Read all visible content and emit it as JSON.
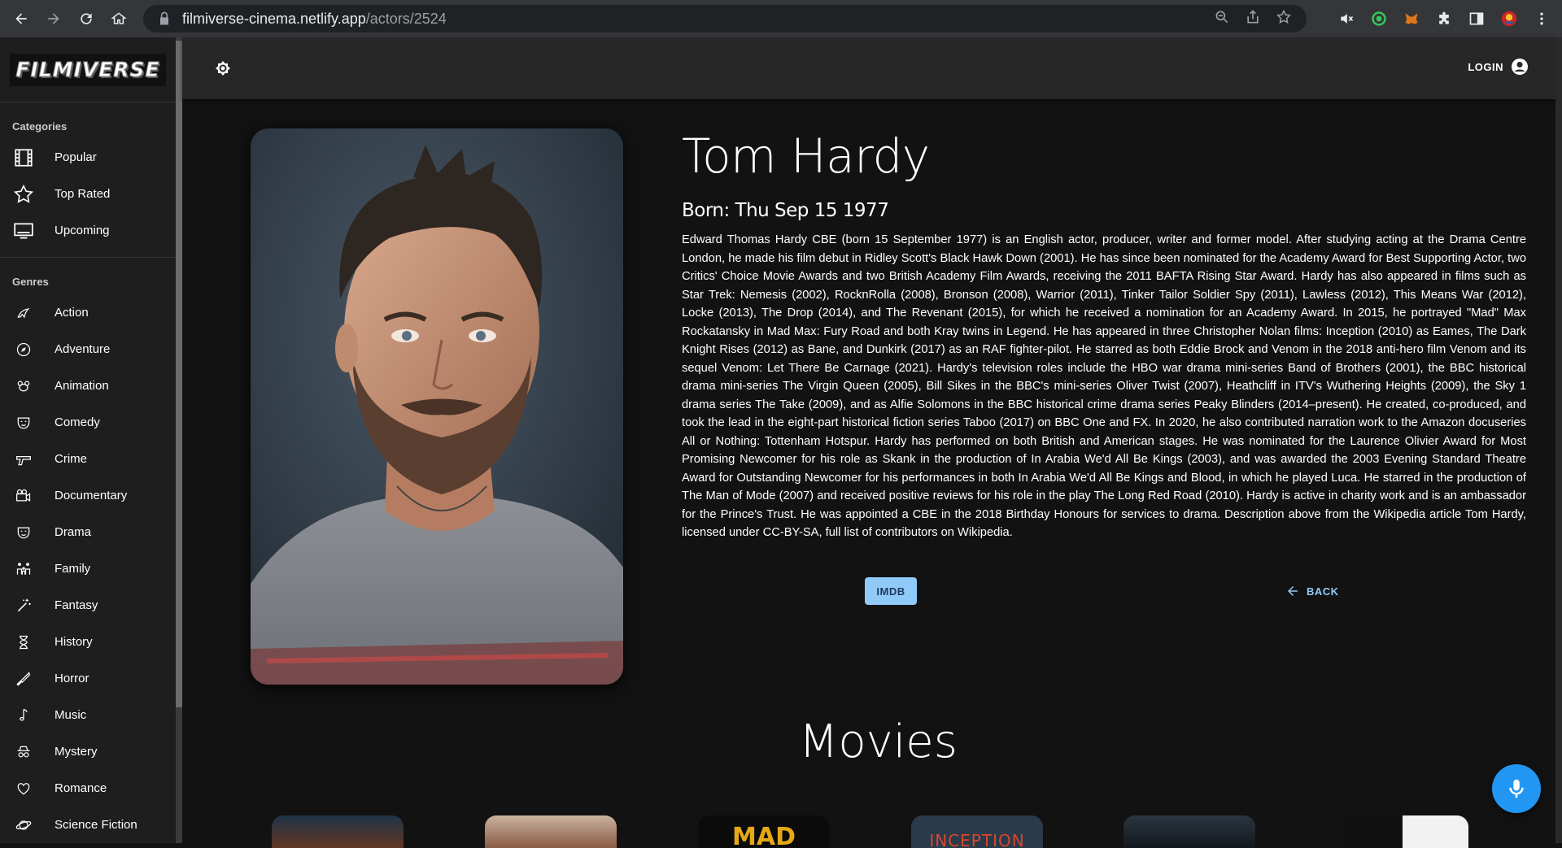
{
  "browser": {
    "url_host": "filmiverse-cinema.netlify.app",
    "url_path": "/actors/2524"
  },
  "sidebar": {
    "logo_text": "FILMIVERSE",
    "categories_title": "Categories",
    "categories": [
      {
        "label": "Popular",
        "icon": "film-icon"
      },
      {
        "label": "Top Rated",
        "icon": "star-icon"
      },
      {
        "label": "Upcoming",
        "icon": "tv-icon"
      }
    ],
    "genres_title": "Genres",
    "genres": [
      {
        "label": "Action",
        "icon": "action-icon"
      },
      {
        "label": "Adventure",
        "icon": "compass-icon"
      },
      {
        "label": "Animation",
        "icon": "animation-icon"
      },
      {
        "label": "Comedy",
        "icon": "mask-icon"
      },
      {
        "label": "Crime",
        "icon": "gun-icon"
      },
      {
        "label": "Documentary",
        "icon": "camera-icon"
      },
      {
        "label": "Drama",
        "icon": "mask-icon"
      },
      {
        "label": "Family",
        "icon": "family-icon"
      },
      {
        "label": "Fantasy",
        "icon": "wand-icon"
      },
      {
        "label": "History",
        "icon": "hourglass-icon"
      },
      {
        "label": "Horror",
        "icon": "knife-icon"
      },
      {
        "label": "Music",
        "icon": "music-note-icon"
      },
      {
        "label": "Mystery",
        "icon": "spy-icon"
      },
      {
        "label": "Romance",
        "icon": "heart-icon"
      },
      {
        "label": "Science Fiction",
        "icon": "planet-icon"
      }
    ]
  },
  "topbar": {
    "login_label": "LOGIN"
  },
  "actor": {
    "name": "Tom Hardy",
    "born": "Born: Thu Sep 15 1977",
    "bio": "Edward Thomas Hardy CBE (born 15 September 1977) is an English actor, producer, writer and former model. After studying acting at the Drama Centre London, he made his film debut in Ridley Scott's Black Hawk Down (2001). He has since been nominated for the Academy Award for Best Supporting Actor, two Critics' Choice Movie Awards and two British Academy Film Awards, receiving the 2011 BAFTA Rising Star Award. Hardy has also appeared in films such as Star Trek: Nemesis (2002), RocknRolla (2008), Bronson (2008), Warrior (2011), Tinker Tailor Soldier Spy (2011), Lawless (2012), This Means War (2012), Locke (2013), The Drop (2014), and The Revenant (2015), for which he received a nomination for an Academy Award. In 2015, he portrayed \"Mad\" Max Rockatansky in Mad Max: Fury Road and both Kray twins in Legend. He has appeared in three Christopher Nolan films: Inception (2010) as Eames, The Dark Knight Rises (2012) as Bane, and Dunkirk (2017) as an RAF fighter-pilot. He starred as both Eddie Brock and Venom in the 2018 anti-hero film Venom and its sequel Venom: Let There Be Carnage (2021). Hardy's television roles include the HBO war drama mini-series Band of Brothers (2001), the BBC historical drama mini-series The Virgin Queen (2005), Bill Sikes in the BBC's mini-series Oliver Twist (2007), Heathcliff in ITV's Wuthering Heights (2009), the Sky 1 drama series The Take (2009), and as Alfie Solomons in the BBC historical crime drama series Peaky Blinders (2014–present). He created, co-produced, and took the lead in the eight-part historical fiction series Taboo (2017) on BBC One and FX. In 2020, he also contributed narration work to the Amazon docuseries All or Nothing: Tottenham Hotspur. Hardy has performed on both British and American stages. He was nominated for the Laurence Olivier Award for Most Promising Newcomer for his role as Skank in the production of In Arabia We'd All Be Kings (2003), and was awarded the 2003 Evening Standard Theatre Award for Outstanding Newcomer for his performances in both In Arabia We'd All Be Kings and Blood, in which he played Luca. He starred in the production of The Man of Mode (2007) and received positive reviews for his role in the play The Long Red Road (2010). Hardy is active in charity work and is an ambassador for the Prince's Trust. He was appointed a CBE in the 2018 Birthday Honours for services to drama. Description above from the Wikipedia article Tom Hardy, licensed under CC-BY-SA, full list of contributors on Wikipedia."
  },
  "buttons": {
    "imdb": "IMDB",
    "back": "BACK"
  },
  "movies": {
    "title": "Movies",
    "thumbnails": [
      {
        "partial_text": ""
      },
      {
        "partial_text": ""
      },
      {
        "partial_text": "MAD"
      },
      {
        "partial_text": "INCEPTION"
      },
      {
        "partial_text": ""
      },
      {
        "partial_text": ""
      }
    ]
  },
  "colors": {
    "accent": "#90caf9",
    "mic": "#2196f3",
    "background": "#121212"
  }
}
